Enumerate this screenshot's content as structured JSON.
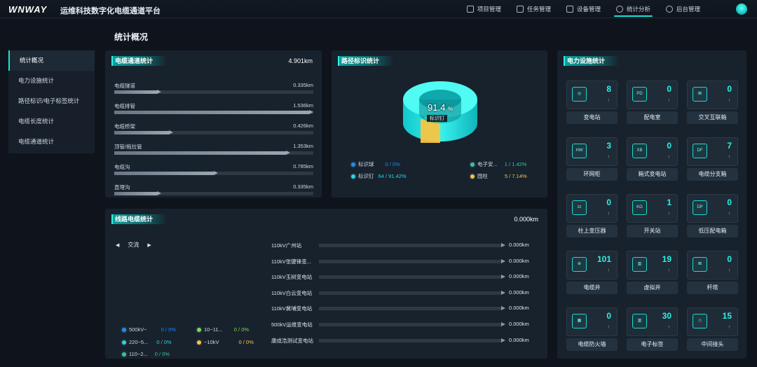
{
  "app": {
    "logo": "WNWAY",
    "title": "运维科技数字化电缆通道平台"
  },
  "nav": [
    {
      "label": "项目管理",
      "icon": "grid-icon"
    },
    {
      "label": "任务管理",
      "icon": "task-icon"
    },
    {
      "label": "设备管理",
      "icon": "device-icon"
    },
    {
      "label": "统计分析",
      "icon": "chart-icon",
      "active": true
    },
    {
      "label": "后台管理",
      "icon": "settings-icon"
    }
  ],
  "page_title": "统计概况",
  "sidebar": [
    {
      "label": "统计概况",
      "active": true
    },
    {
      "label": "电力设施统计"
    },
    {
      "label": "路径标识/电子标签统计"
    },
    {
      "label": "电缆长度统计"
    },
    {
      "label": "电缆通道统计"
    }
  ],
  "channel": {
    "title": "电缆通道统计",
    "total": "4.901km",
    "rows": [
      {
        "label": "电缆隧道",
        "value": "0.335km",
        "fraction": 0.22
      },
      {
        "label": "电缆排管",
        "value": "1.536km",
        "fraction": 1.0
      },
      {
        "label": "电缆桥架",
        "value": "0.426km",
        "fraction": 0.28
      },
      {
        "label": "顶管/拖拉管",
        "value": "1.353km",
        "fraction": 0.88
      },
      {
        "label": "电缆沟",
        "value": "0.785km",
        "fraction": 0.51
      },
      {
        "label": "直埋沟",
        "value": "0.335km",
        "fraction": 0.22
      }
    ]
  },
  "marker": {
    "title": "路径标识统计",
    "center_value": "91.4",
    "center_unit": "%",
    "center_label": "标识钉",
    "legend": [
      {
        "name": "标识球",
        "value": "0 / 0%",
        "color": "#1a8cff"
      },
      {
        "name": "电子安...",
        "value": "1 / 1.42%",
        "color": "#2ec9a0"
      },
      {
        "name": "标识钉",
        "value": "64 / 91.42%",
        "color": "#22d8e6"
      },
      {
        "name": "园柱",
        "value": "5 / 7.14%",
        "color": "#f5c542"
      }
    ]
  },
  "facility": {
    "title": "电力设施统计",
    "items": [
      {
        "name": "变电站",
        "count": "8",
        "icon": "substation-icon",
        "code": "◎"
      },
      {
        "name": "配电室",
        "count": "0",
        "icon": "distribution-room-icon",
        "code": "PD"
      },
      {
        "name": "交叉互联箱",
        "count": "0",
        "icon": "cross-connect-box-icon",
        "code": "⊠"
      },
      {
        "name": "环网柜",
        "count": "3",
        "icon": "ring-main-unit-icon",
        "code": "HW"
      },
      {
        "name": "箱式变电站",
        "count": "0",
        "icon": "box-substation-icon",
        "code": "XB"
      },
      {
        "name": "电缆分支箱",
        "count": "7",
        "icon": "branch-box-icon",
        "code": "DF"
      },
      {
        "name": "柱上变压器",
        "count": "0",
        "icon": "pole-transformer-icon",
        "code": "⊟"
      },
      {
        "name": "开关站",
        "count": "1",
        "icon": "switch-station-icon",
        "code": "KG"
      },
      {
        "name": "低压配电箱",
        "count": "0",
        "icon": "lv-box-icon",
        "code": "DP"
      },
      {
        "name": "电缆井",
        "count": "101",
        "icon": "cable-well-icon",
        "code": "⊕"
      },
      {
        "name": "虚拟井",
        "count": "19",
        "icon": "virtual-well-icon",
        "code": "▥"
      },
      {
        "name": "杆塔",
        "count": "0",
        "icon": "tower-icon",
        "code": "⊠"
      },
      {
        "name": "电缆防火墙",
        "count": "0",
        "icon": "firewall-icon",
        "code": "▦"
      },
      {
        "name": "电子标签",
        "count": "30",
        "icon": "e-tag-icon",
        "code": "▥"
      },
      {
        "name": "中间接头",
        "count": "15",
        "icon": "joint-icon",
        "code": "◇"
      }
    ]
  },
  "line": {
    "title": "线路电缆统计",
    "total": "0.000km",
    "selector": "交流",
    "legend": [
      {
        "name": "500kV~",
        "value": "0 / 0%",
        "color": "#1a8cff"
      },
      {
        "name": "10~11...",
        "value": "0 / 0%",
        "color": "#7ed957"
      },
      {
        "name": "220~5...",
        "value": "0 / 0%",
        "color": "#22d8e6"
      },
      {
        "name": "~10kV",
        "value": "0 / 0%",
        "color": "#f5c542"
      },
      {
        "name": "110~2...",
        "value": "0 / 0%",
        "color": "#2ec9a0"
      }
    ],
    "stations": [
      {
        "name": "110kV广州站",
        "value": "0.000km"
      },
      {
        "name": "110kV张键锋变...",
        "value": "0.000km"
      },
      {
        "name": "110kV玉树变电站",
        "value": "0.000km"
      },
      {
        "name": "110kV白云变电站",
        "value": "0.000km"
      },
      {
        "name": "110kV冀埔变电站",
        "value": "0.000km"
      },
      {
        "name": "500kV运维变电站",
        "value": "0.000km"
      },
      {
        "name": "康成浩测试变电站",
        "value": "0.000km"
      }
    ]
  }
}
